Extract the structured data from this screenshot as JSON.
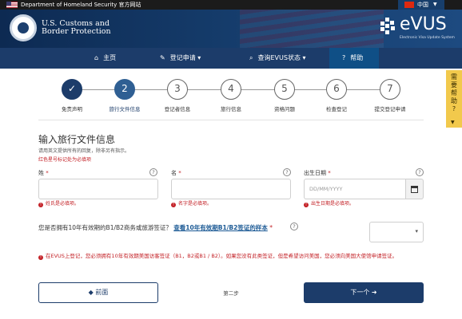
{
  "gov_bar": {
    "agency_text": "Department of Homeland Security 官方网站",
    "language": "中国"
  },
  "header": {
    "agency_line1": "U.S. Customs and",
    "agency_line2": "Border Protection",
    "logo_word": "eVUS",
    "logo_sub": "Electronic Visa Update System"
  },
  "nav": {
    "home": "主页",
    "register": "登记申请",
    "status": "查询EVUS状态",
    "help": "帮助"
  },
  "help_tab": {
    "label_lines": [
      "需",
      "要",
      "帮",
      "助",
      "?"
    ]
  },
  "steps": [
    {
      "num": "✓",
      "label": "免责声明"
    },
    {
      "num": "2",
      "label": "旅行文件信息"
    },
    {
      "num": "3",
      "label": "登记者信息"
    },
    {
      "num": "4",
      "label": "旅行信息"
    },
    {
      "num": "5",
      "label": "资格问题"
    },
    {
      "num": "6",
      "label": "检查登记"
    },
    {
      "num": "7",
      "label": "提交登记申请"
    }
  ],
  "form": {
    "title": "输入旅行文件信息",
    "intro": "请用英文提供所有的回复，除非另有指示。",
    "required_note": "红色星号标记处为必填项",
    "surname": {
      "label": "姓",
      "error": "姓氏是必填项。"
    },
    "given_name": {
      "label": "名",
      "error": "名字是必填项。"
    },
    "dob": {
      "label": "出生日期",
      "placeholder": "DD/MM/YYYY",
      "error": "出生日期是必填项。"
    },
    "visa_question": {
      "text": "您是否拥有10年有效期的B1/B2商务或旅游签证？",
      "link": "查看10年有效期B1/B2签证的样本",
      "error": "在EVUS上登记，您必须拥有10年有效期美国访客签证（B1，B2或B1 / B2）。如果您没有此类签证，但是希望访问美国，您必须向美国大使馆申请签证。"
    },
    "required_mark": "*",
    "help_mark": "?",
    "error_mark": "!"
  },
  "footer": {
    "prev_label": "◆ 前面",
    "step_label": "第二步",
    "next_label": "下一个 ➜"
  },
  "colors": {
    "navy": "#1c3c6a",
    "error": "#c32026",
    "help_tab": "#f2c94c"
  }
}
